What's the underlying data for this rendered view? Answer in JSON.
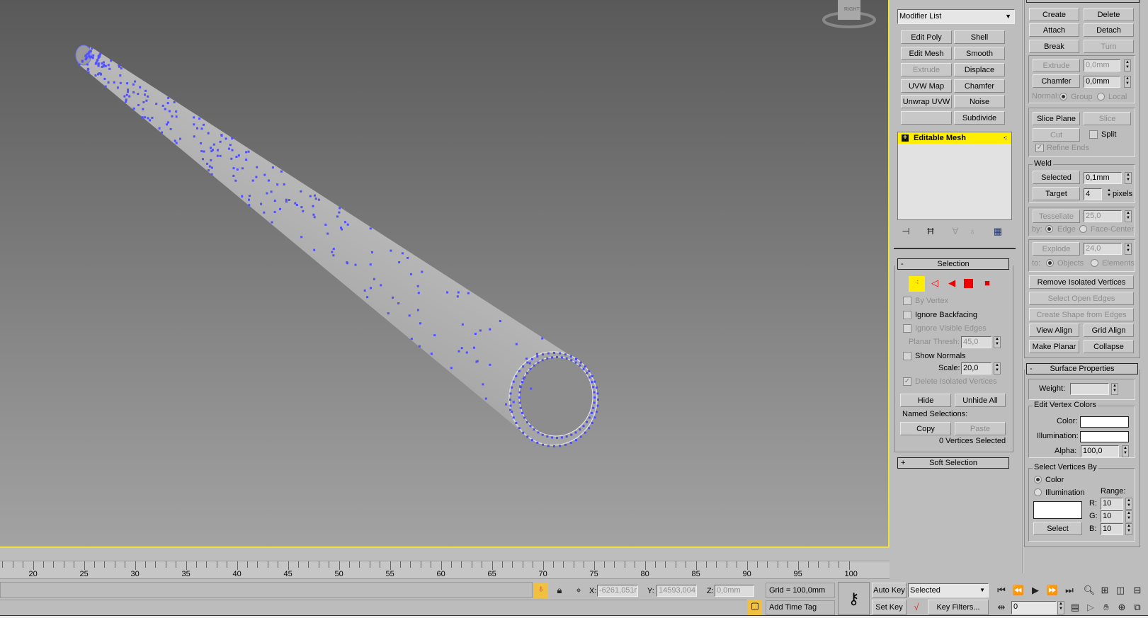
{
  "viewport": {
    "viewcube_label": "RIGHT",
    "border_color": "#f0e040"
  },
  "modifier_panel": {
    "modifier_list": "Modifier List",
    "quick_buttons": [
      "Edit Poly",
      "Shell",
      "Edit Mesh",
      "Smooth",
      "Extrude",
      "Displace",
      "UVW Map",
      "Chamfer",
      "Unwrap UVW",
      "Noise",
      "",
      "Subdivide"
    ],
    "stack_item": "Editable Mesh",
    "stack_highlight": "#ffee00"
  },
  "selection": {
    "title": "Selection",
    "collapse": "-",
    "by_vertex": "By Vertex",
    "ignore_backfacing": "Ignore Backfacing",
    "ignore_visible_edges": "Ignore Visible Edges",
    "planar_thresh_label": "Planar Thresh:",
    "planar_thresh": "45,0",
    "show_normals": "Show Normals",
    "scale_label": "Scale:",
    "scale": "20,0",
    "delete_isolated": "Delete Isolated Vertices",
    "hide": "Hide",
    "unhide_all": "Unhide All",
    "named_selections": "Named Selections:",
    "copy": "Copy",
    "paste": "Paste",
    "status": "0 Vertices Selected"
  },
  "soft_selection": {
    "title": "Soft Selection",
    "expand": "+"
  },
  "edit_geometry": {
    "create": "Create",
    "delete": "Delete",
    "attach": "Attach",
    "detach": "Detach",
    "break": "Break",
    "turn": "Turn",
    "extrude": "Extrude",
    "extrude_val": "0,0mm",
    "chamfer": "Chamfer",
    "chamfer_val": "0,0mm",
    "normal_label": "Normal:",
    "group": "Group",
    "local": "Local",
    "slice_plane": "Slice Plane",
    "slice": "Slice",
    "cut": "Cut",
    "split": "Split",
    "refine_ends": "Refine Ends",
    "weld_label": "Weld",
    "weld_selected": "Selected",
    "weld_selected_val": "0,1mm",
    "weld_target": "Target",
    "weld_target_val": "4",
    "pixels": "pixels",
    "tessellate": "Tessellate",
    "tessellate_val": "25,0",
    "by_label": "by:",
    "edge": "Edge",
    "face_center": "Face-Center",
    "explode": "Explode",
    "explode_val": "24,0",
    "to_label": "to:",
    "objects": "Objects",
    "elements": "Elements",
    "remove_isolated": "Remove Isolated Vertices",
    "select_open_edges": "Select Open Edges",
    "create_shape": "Create Shape from Edges",
    "view_align": "View Align",
    "grid_align": "Grid Align",
    "make_planar": "Make Planar",
    "collapse": "Collapse"
  },
  "surface_properties": {
    "title": "Surface Properties",
    "collapse": "-",
    "weight_label": "Weight:",
    "edit_vertex_colors": "Edit Vertex Colors",
    "color_label": "Color:",
    "illumination_label": "Illumination:",
    "alpha_label": "Alpha:",
    "alpha": "100,0",
    "select_vertices_by": "Select Vertices By",
    "by_color": "Color",
    "by_illumination": "Illumination",
    "range_label": "Range:",
    "r_label": "R:",
    "r": "10",
    "g_label": "G:",
    "g": "10",
    "b_label": "B:",
    "b": "10",
    "select": "Select"
  },
  "timeline": {
    "ticks": [
      "20",
      "25",
      "30",
      "35",
      "40",
      "45",
      "50",
      "55",
      "60",
      "65",
      "70",
      "75",
      "80",
      "85",
      "90",
      "95",
      "100"
    ]
  },
  "status": {
    "x_label": "X:",
    "x": "-6261,051r",
    "y_label": "Y:",
    "y": "14593,004",
    "z_label": "Z:",
    "z": "0,0mm",
    "grid": "Grid = 100,0mm",
    "add_time_tag": "Add Time Tag",
    "auto_key": "Auto Key",
    "set_key": "Set Key",
    "key_mode": "Selected",
    "key_filters": "Key Filters...",
    "frame": "0"
  }
}
